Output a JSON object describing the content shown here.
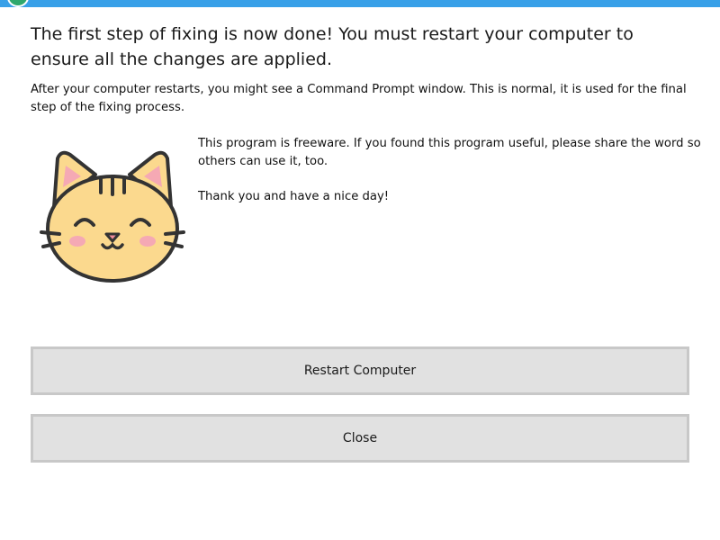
{
  "window": {
    "accent_color": "#38a0e8",
    "icon": "app-icon"
  },
  "message": {
    "heading": "The first step of fixing is now done! You must restart your computer to ensure all the changes are applied.",
    "detail": "After your computer restarts, you might see a Command Prompt window. This is normal, it is used for the final step of the fixing process."
  },
  "info": {
    "freeware": "This program is freeware. If you found this program useful, please share the word so others can use it, too.",
    "thanks": "Thank you and have a nice day!"
  },
  "illustration": {
    "icon": "cat-face-icon"
  },
  "buttons": {
    "restart_label": "Restart Computer",
    "close_label": "Close"
  }
}
